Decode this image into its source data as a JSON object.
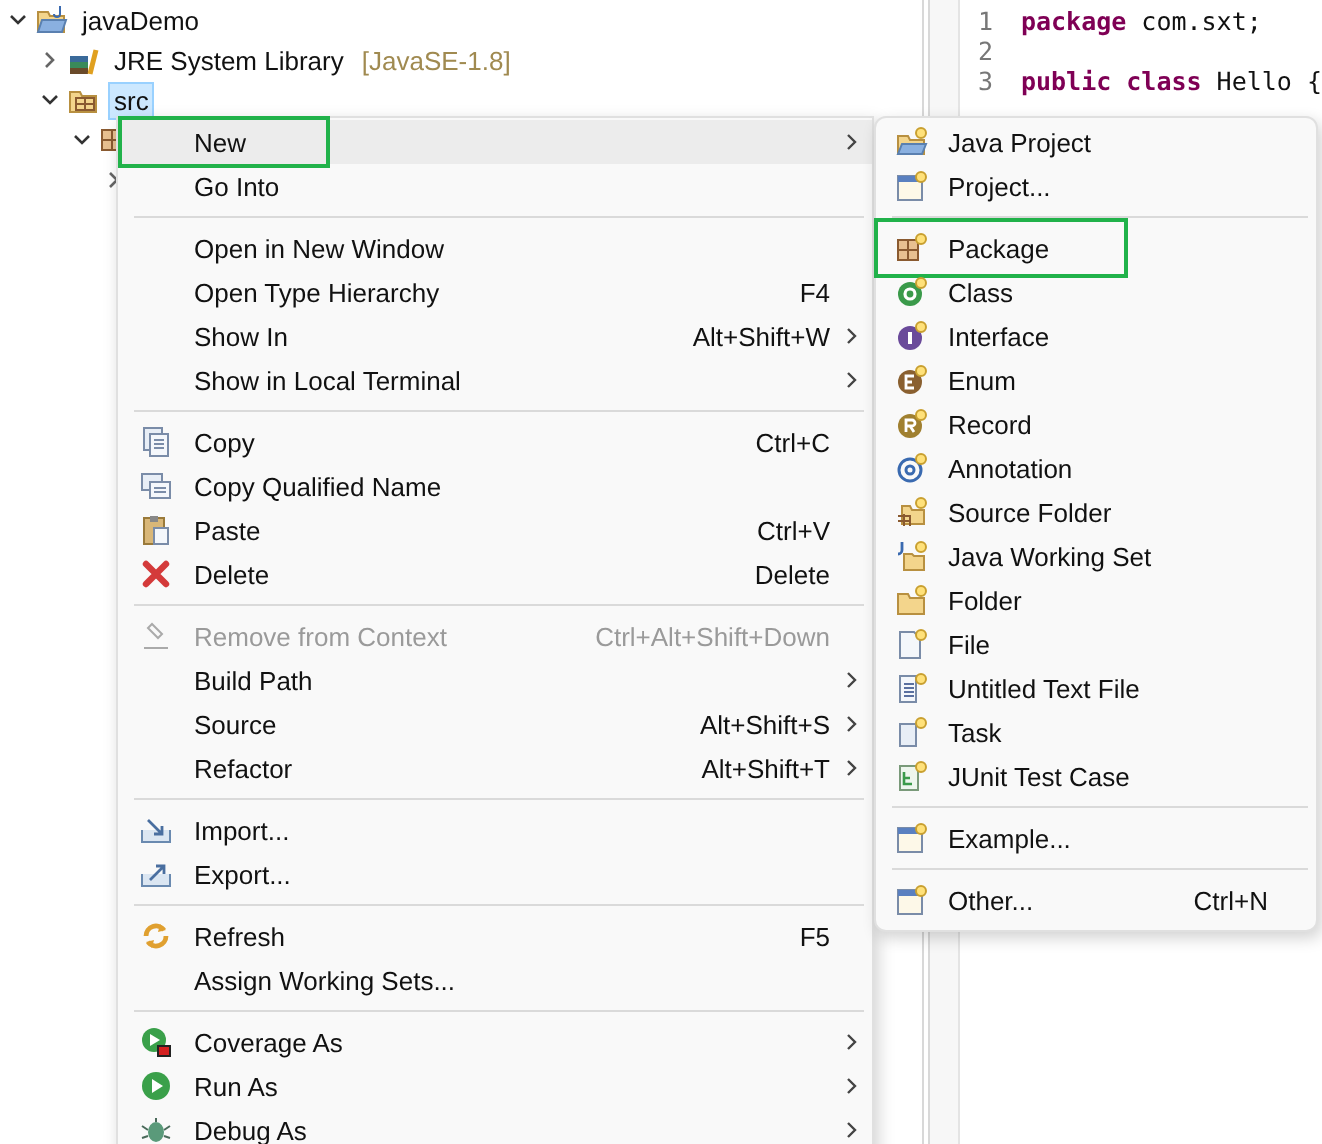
{
  "tree": [
    {
      "label": "javaDemo",
      "expanded": true,
      "selected": false,
      "children": [
        {
          "label": "JRE System Library",
          "suffix": "[JavaSE-1.8]",
          "expanded": false,
          "selected": false
        },
        {
          "label": "src",
          "expanded": true,
          "selected": true,
          "children": [
            {
              "expanded": true,
              "children": [
                {
                  "expanded": false
                }
              ]
            }
          ]
        }
      ]
    }
  ],
  "editor": {
    "lines": [
      {
        "number": "1",
        "tokens": [
          {
            "text": "package",
            "kind": "keyword"
          },
          {
            "text": " com.sxt;",
            "kind": "plain"
          }
        ]
      },
      {
        "number": "2"
      },
      {
        "number": "3",
        "tokens": [
          {
            "text": "public",
            "kind": "keyword"
          },
          {
            "text": " class",
            "kind": "keyword"
          },
          {
            "text": " Hello {",
            "kind": "plain"
          }
        ]
      }
    ]
  },
  "context_menu": {
    "items": [
      {
        "kind": "item",
        "label": "New",
        "submenu": true,
        "selected": true,
        "outlined": true,
        "disabled": false
      },
      {
        "kind": "item",
        "label": "Go Into",
        "submenu": false,
        "selected": false,
        "outlined": false,
        "disabled": false
      },
      {
        "kind": "separator"
      },
      {
        "kind": "item",
        "label": "Open in New Window",
        "submenu": false,
        "selected": false,
        "outlined": false,
        "disabled": false
      },
      {
        "kind": "item",
        "label": "Open Type Hierarchy",
        "shortcut": "F4",
        "submenu": false,
        "selected": false,
        "outlined": false,
        "disabled": false
      },
      {
        "kind": "item",
        "label": "Show In",
        "shortcut": "Alt+Shift+W",
        "submenu": true,
        "selected": false,
        "outlined": false,
        "disabled": false
      },
      {
        "kind": "item",
        "label": "Show in Local Terminal",
        "submenu": true,
        "selected": false,
        "outlined": false,
        "disabled": false
      },
      {
        "kind": "separator"
      },
      {
        "kind": "item",
        "label": "Copy",
        "shortcut": "Ctrl+C",
        "submenu": false,
        "selected": false,
        "outlined": false,
        "disabled": false
      },
      {
        "kind": "item",
        "label": "Copy Qualified Name",
        "submenu": false,
        "selected": false,
        "outlined": false,
        "disabled": false
      },
      {
        "kind": "item",
        "label": "Paste",
        "shortcut": "Ctrl+V",
        "submenu": false,
        "selected": false,
        "outlined": false,
        "disabled": false
      },
      {
        "kind": "item",
        "label": "Delete",
        "shortcut": "Delete",
        "submenu": false,
        "selected": false,
        "outlined": false,
        "disabled": false
      },
      {
        "kind": "separator"
      },
      {
        "kind": "item",
        "label": "Remove from Context",
        "shortcut": "Ctrl+Alt+Shift+Down",
        "submenu": false,
        "selected": false,
        "outlined": false,
        "disabled": true
      },
      {
        "kind": "item",
        "label": "Build Path",
        "submenu": true,
        "selected": false,
        "outlined": false,
        "disabled": false
      },
      {
        "kind": "item",
        "label": "Source",
        "shortcut": "Alt+Shift+S",
        "submenu": true,
        "selected": false,
        "outlined": false,
        "disabled": false
      },
      {
        "kind": "item",
        "label": "Refactor",
        "shortcut": "Alt+Shift+T",
        "submenu": true,
        "selected": false,
        "outlined": false,
        "disabled": false
      },
      {
        "kind": "separator"
      },
      {
        "kind": "item",
        "label": "Import...",
        "submenu": false,
        "selected": false,
        "outlined": false,
        "disabled": false
      },
      {
        "kind": "item",
        "label": "Export...",
        "submenu": false,
        "selected": false,
        "outlined": false,
        "disabled": false
      },
      {
        "kind": "separator"
      },
      {
        "kind": "item",
        "label": "Refresh",
        "shortcut": "F5",
        "submenu": false,
        "selected": false,
        "outlined": false,
        "disabled": false
      },
      {
        "kind": "item",
        "label": "Assign Working Sets...",
        "submenu": false,
        "selected": false,
        "outlined": false,
        "disabled": false
      },
      {
        "kind": "separator"
      },
      {
        "kind": "item",
        "label": "Coverage As",
        "submenu": true,
        "selected": false,
        "outlined": false,
        "disabled": false
      },
      {
        "kind": "item",
        "label": "Run As",
        "submenu": true,
        "selected": false,
        "outlined": false,
        "disabled": false
      },
      {
        "kind": "item",
        "label": "Debug As",
        "submenu": true,
        "selected": false,
        "outlined": false,
        "disabled": false
      }
    ]
  },
  "submenu": {
    "items": [
      {
        "kind": "item",
        "label": "Java Project",
        "selected": false,
        "outlined": false
      },
      {
        "kind": "item",
        "label": "Project...",
        "selected": false,
        "outlined": false
      },
      {
        "kind": "separator"
      },
      {
        "kind": "item",
        "label": "Package",
        "selected": false,
        "outlined": true
      },
      {
        "kind": "item",
        "label": "Class",
        "selected": false,
        "outlined": false
      },
      {
        "kind": "item",
        "label": "Interface",
        "selected": false,
        "outlined": false
      },
      {
        "kind": "item",
        "label": "Enum",
        "selected": false,
        "outlined": false
      },
      {
        "kind": "item",
        "label": "Record",
        "selected": false,
        "outlined": false
      },
      {
        "kind": "item",
        "label": "Annotation",
        "selected": false,
        "outlined": false
      },
      {
        "kind": "item",
        "label": "Source Folder",
        "selected": false,
        "outlined": false
      },
      {
        "kind": "item",
        "label": "Java Working Set",
        "selected": false,
        "outlined": false
      },
      {
        "kind": "item",
        "label": "Folder",
        "selected": false,
        "outlined": false
      },
      {
        "kind": "item",
        "label": "File",
        "selected": false,
        "outlined": false
      },
      {
        "kind": "item",
        "label": "Untitled Text File",
        "selected": false,
        "outlined": false
      },
      {
        "kind": "item",
        "label": "Task",
        "selected": false,
        "outlined": false
      },
      {
        "kind": "item",
        "label": "JUnit Test Case",
        "selected": false,
        "outlined": false
      },
      {
        "kind": "separator"
      },
      {
        "kind": "item",
        "label": "Example...",
        "selected": false,
        "outlined": false
      },
      {
        "kind": "separator"
      },
      {
        "kind": "item",
        "label": "Other...",
        "shortcut": "Ctrl+N",
        "selected": false,
        "outlined": false
      }
    ]
  }
}
